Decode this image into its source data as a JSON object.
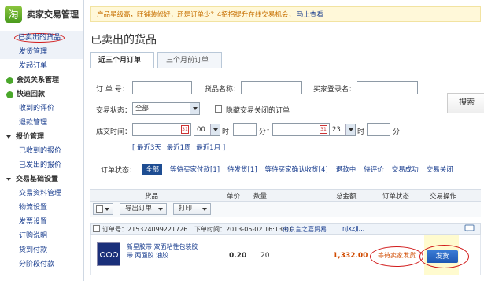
{
  "brand": {
    "title": "卖家交易管理",
    "icon": "taobao-app-icon"
  },
  "sidebar": {
    "items": [
      {
        "label": "已卖出的货品",
        "active": true,
        "circled": true
      },
      {
        "label": "发货管理",
        "active": true
      },
      {
        "label": "发起订单"
      }
    ],
    "groups": [
      {
        "label": "会员关系管理",
        "icon": "green-dot-icon"
      },
      {
        "label": "快速回款",
        "icon": "green-dot-icon"
      }
    ],
    "sub_items_a": [
      "收到的评价",
      "退款管理"
    ],
    "group_price": "报价管理",
    "sub_items_b": [
      "已收到的报价",
      "已发出的报价"
    ],
    "group_trade": "交易基础设置",
    "sub_items_c": [
      "交易资料管理",
      "物流设置",
      "发票设置",
      "订购说明",
      "货到付款",
      "分阶段付款"
    ]
  },
  "notice": {
    "text": "产品星级高，旺铺装修好，还是订单少？4招招提升在线交易机会，",
    "link": "马上查看"
  },
  "page_title": "已卖出的货品",
  "tabs": [
    "近三个月订单",
    "三个月前订单"
  ],
  "form": {
    "order_no_label": "订 单 号：",
    "goods_name_label": "货品名称：",
    "buyer_label": "买家登录名：",
    "trade_status_label": "交易状态：",
    "trade_status_value": "全部",
    "hide_closed_label": "隐藏交易关闭的订单",
    "time_label": "成交时间：",
    "hour_start": "00",
    "hour_end": "23",
    "hour_unit": "时",
    "min_unit": "分",
    "dash": "-",
    "search_label": "搜索",
    "quick_ranges": [
      "[ 最近3天",
      "最近1周",
      "最近1月 ]"
    ]
  },
  "filter": {
    "label": "订单状态：",
    "items": [
      {
        "label": "全部",
        "active": true
      },
      {
        "label": "等待买家付款",
        "count": "[1]"
      },
      {
        "label": "待发货",
        "count": "[1]"
      },
      {
        "label": "等待买家确认收货",
        "count": "[4]"
      },
      {
        "label": "退款中"
      },
      {
        "label": "待评价"
      },
      {
        "label": "交易成功"
      },
      {
        "label": "交易关闭"
      }
    ]
  },
  "table": {
    "headers": [
      "货品",
      "单价",
      "数量",
      "总金额",
      "订单状态",
      "交易操作"
    ],
    "export_label": "导出订单",
    "print_label": "打印"
  },
  "order": {
    "order_no": "订单号：215324099221726",
    "time": "下单时间：2013-05-02 16:13:01",
    "company": "南京言之嘉贸易...",
    "buyer": "njxzjj...",
    "product_title": "新星胶带 双面粘性包装胶带 两面胶 油胶",
    "unit_price": "0.20",
    "quantity": "20",
    "total": "1,332.00",
    "status": "等待卖家发货",
    "action": "发货"
  },
  "colors": {
    "accent": "#1e4d92",
    "price": "#d14b00",
    "circle": "#d11a1a"
  }
}
